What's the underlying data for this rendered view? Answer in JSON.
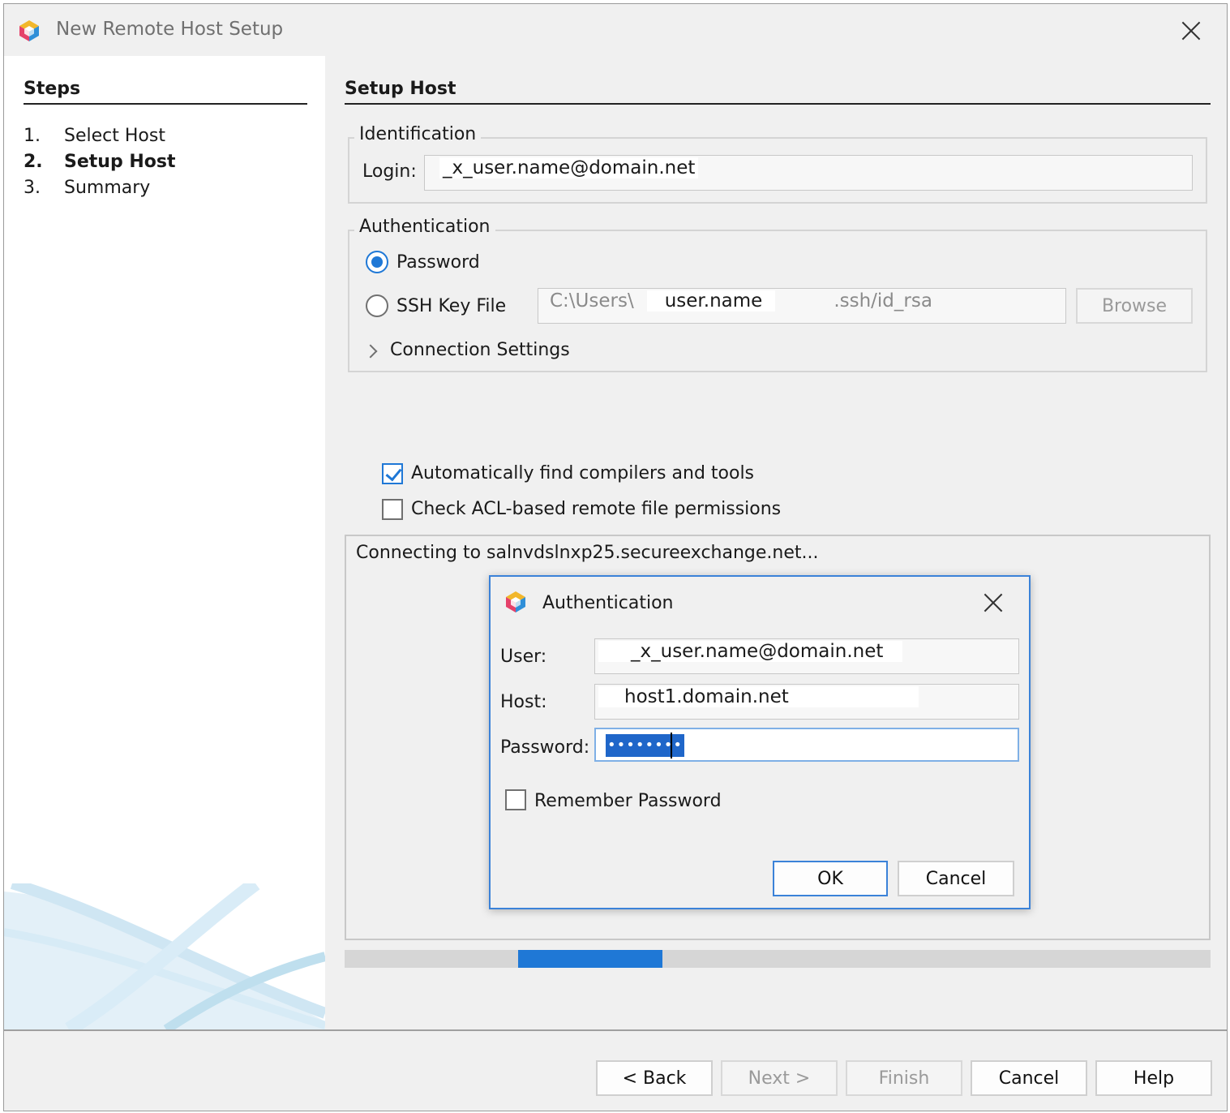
{
  "window": {
    "title": "New Remote Host Setup",
    "icon": "netbeans-cube-icon"
  },
  "steps": {
    "title": "Steps",
    "items": [
      {
        "num": "1.",
        "label": "Select Host"
      },
      {
        "num": "2.",
        "label": "Setup Host"
      },
      {
        "num": "3.",
        "label": "Summary"
      }
    ],
    "active_index": 1
  },
  "setup": {
    "title": "Setup Host",
    "identification": {
      "legend": "Identification",
      "login_label": "Login:",
      "login_value": "_x_user.name@domain.net"
    },
    "authentication": {
      "legend": "Authentication",
      "password_option": "Password",
      "ssh_option": "SSH Key File",
      "ssh_path_prefix": "C:\\Users\\",
      "ssh_path_user": "user.name",
      "ssh_path_suffix": ".ssh/id_rsa",
      "browse_label": "Browse",
      "connection_settings": "Connection Settings",
      "selected": "Password"
    },
    "auto_find_label": "Automatically find compilers and tools",
    "auto_find_checked": true,
    "acl_label": "Check ACL-based remote file permissions",
    "acl_checked": false,
    "status_text": "Connecting to salnvdslnxp25.secureexchange.net...",
    "progress": {
      "start": 0.2,
      "end": 0.367
    }
  },
  "auth_dialog": {
    "title": "Authentication",
    "user_label": "User:",
    "user_value": "_x_user.name@domain.net",
    "host_label": "Host:",
    "host_value": "host1.domain.net",
    "password_label": "Password:",
    "password_mask": "••••••••",
    "remember_label": "Remember Password",
    "remember_checked": false,
    "ok_label": "OK",
    "cancel_label": "Cancel"
  },
  "footer": {
    "back_label": "< Back",
    "next_label": "Next >",
    "finish_label": "Finish",
    "cancel_label": "Cancel",
    "help_label": "Help"
  },
  "colors": {
    "accent": "#1f78d6",
    "focus_border": "#3b82d8",
    "selection": "#1f66c9"
  }
}
